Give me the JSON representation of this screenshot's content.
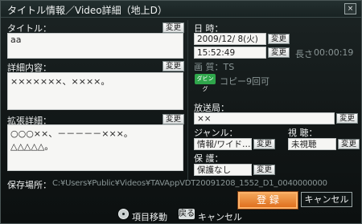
{
  "window": {
    "title": "タイトル情報／Video詳細（地上D）",
    "close_label": "×"
  },
  "left": {
    "title_label": "タイトル：",
    "title_change": "変更",
    "title_value": "aa",
    "details_label": "詳細内容：",
    "details_change": "変更",
    "details_value": "×××××××、××××。",
    "extended_label": "拡張詳細：",
    "extended_change": "変更",
    "extended_line1": "○○○××、－－－－－×××。",
    "extended_line2": "△△△△△。"
  },
  "right": {
    "datetime_label": "日 時：",
    "date_value": "2009/12/ 8(火)",
    "date_change": "変更",
    "time_value": "15:52:49",
    "time_change": "変更",
    "length_label": "長さ",
    "length_value": "00:00:19",
    "quality_label": "画 質：TS",
    "dubbing_icon_label": "ダビング",
    "copy_label": "コピー9回可",
    "station_label": "放送局：",
    "station_value": "××",
    "station_change": "変更",
    "genre_label": "ジャンル：",
    "genre_value": "情報/ワイド…",
    "genre_change": "変更",
    "watch_label": "視 聴：",
    "watch_value": "未視聴",
    "watch_change": "変更",
    "protect_label": "保 護：",
    "protect_value": "保護なし",
    "protect_change": "変更"
  },
  "path": {
    "label": "保存場所：",
    "value": "C:¥Users¥Public¥Videos¥TAVAppVDT20091208_1552_D1_0040000000"
  },
  "buttons": {
    "register": "登 録",
    "cancel": "キャンセル"
  },
  "footer": {
    "move_label": "項目移動",
    "back_key": "戻る",
    "back_label": "キャンセル"
  }
}
